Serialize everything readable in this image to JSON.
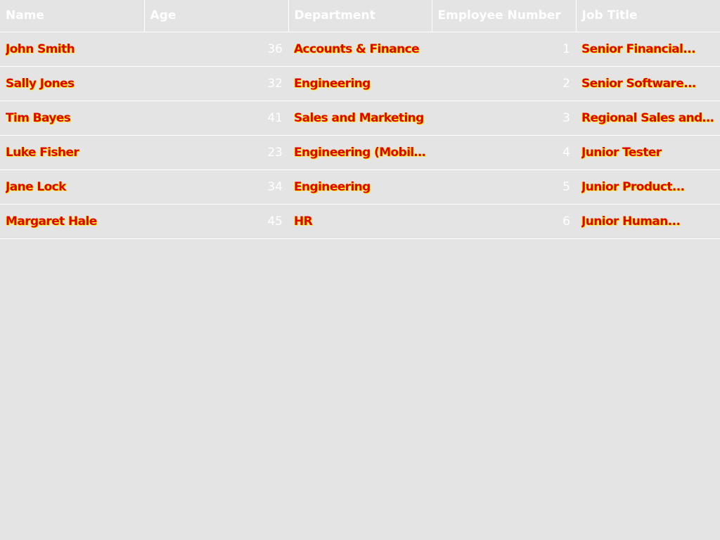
{
  "table": {
    "columns": [
      "Name",
      "Age",
      "Department",
      "Employee Number",
      "Job Title"
    ],
    "rows": [
      {
        "name": "John Smith",
        "age": "36",
        "department": "Accounts & Finance",
        "employee_number": "1",
        "job_title": "Senior Financial..."
      },
      {
        "name": "Sally Jones",
        "age": "32",
        "department": "Engineering",
        "employee_number": "2",
        "job_title": "Senior Software..."
      },
      {
        "name": "Tim Bayes",
        "age": "41",
        "department": "Sales and Marketing",
        "employee_number": "3",
        "job_title": "Regional Sales and..."
      },
      {
        "name": "Luke Fisher",
        "age": "23",
        "department": "Engineering (Mobile...",
        "employee_number": "4",
        "job_title": "Junior Tester"
      },
      {
        "name": "Jane Lock",
        "age": "34",
        "department": "Engineering",
        "employee_number": "5",
        "job_title": "Junior Product..."
      },
      {
        "name": "Margaret Hale",
        "age": "45",
        "department": "HR",
        "employee_number": "6",
        "job_title": "Junior Human..."
      }
    ]
  },
  "colors": {
    "background": "#e4e4e4",
    "header_text": "#ffffff",
    "cell_text": "#e00000",
    "cell_text_shadow": "#ffee00",
    "number_text": "#ffffff",
    "grid_lines": "#ffffff"
  }
}
